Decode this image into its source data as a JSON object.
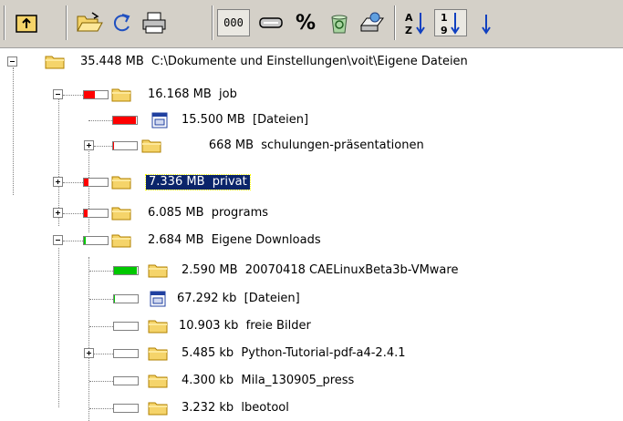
{
  "toolbar": {
    "buttons": [
      {
        "icon": "up-folder-icon"
      },
      {
        "icon": "open-folder-icon"
      },
      {
        "icon": "refresh-icon"
      },
      {
        "icon": "print-icon"
      },
      {
        "icon": "number-format-icon",
        "label": "000"
      },
      {
        "icon": "bar-view-icon"
      },
      {
        "icon": "percent-icon",
        "label": "%"
      },
      {
        "icon": "recycle-bin-icon"
      },
      {
        "icon": "network-drive-icon"
      },
      {
        "icon": "sort-alpha-icon",
        "label": "A Z"
      },
      {
        "icon": "sort-numeric-icon",
        "label": "1 9"
      },
      {
        "icon": "sort-descending-icon"
      }
    ]
  },
  "colors": {
    "bar_red": "#ff0000",
    "bar_green": "#00c800",
    "selection": "#0a246a",
    "folder": "#f5d46a"
  },
  "tree": {
    "rows": [
      {
        "size": "35.448 MB",
        "name": "C:\\Dokumente und Einstellungen\\voit\\Eigene Dateien",
        "icon": "folder-icon"
      },
      {
        "size": "16.168 MB",
        "name": "job",
        "icon": "folder-icon",
        "fill": 0.46,
        "fill_color": "red"
      },
      {
        "size": "15.500 MB",
        "name": "[Dateien]",
        "icon": "files-icon",
        "fill": 0.96,
        "fill_color": "red"
      },
      {
        "size": "668 MB",
        "name": "schulungen-präsentationen",
        "icon": "folder-icon",
        "fill": 0.04,
        "fill_color": "red"
      },
      {
        "size": "7.336 MB",
        "name": "privat",
        "icon": "folder-icon",
        "fill": 0.21,
        "fill_color": "red"
      },
      {
        "size": "6.085 MB",
        "name": "programs",
        "icon": "folder-icon",
        "fill": 0.17,
        "fill_color": "red"
      },
      {
        "size": "2.684 MB",
        "name": "Eigene Downloads",
        "icon": "folder-icon",
        "fill": 0.08,
        "fill_color": "green"
      },
      {
        "size": "2.590 MB",
        "name": "20070418 CAELinuxBeta3b-VMware",
        "icon": "folder-icon",
        "fill": 0.96,
        "fill_color": "green"
      },
      {
        "size": "67.292 kb",
        "name": "[Dateien]",
        "icon": "files-icon",
        "fill": 0.02,
        "fill_color": "green"
      },
      {
        "size": "10.903 kb",
        "name": "freie Bilder",
        "icon": "folder-icon",
        "fill": 0.0,
        "fill_color": "green"
      },
      {
        "size": "5.485 kb",
        "name": "Python-Tutorial-pdf-a4-2.4.1",
        "icon": "folder-icon",
        "fill": 0.0,
        "fill_color": "green"
      },
      {
        "size": "4.300 kb",
        "name": "Mila_130905_press",
        "icon": "folder-icon",
        "fill": 0.0,
        "fill_color": "green"
      },
      {
        "size": "3.232 kb",
        "name": "lbeotool",
        "icon": "folder-icon",
        "fill": 0.0,
        "fill_color": "green"
      }
    ]
  }
}
